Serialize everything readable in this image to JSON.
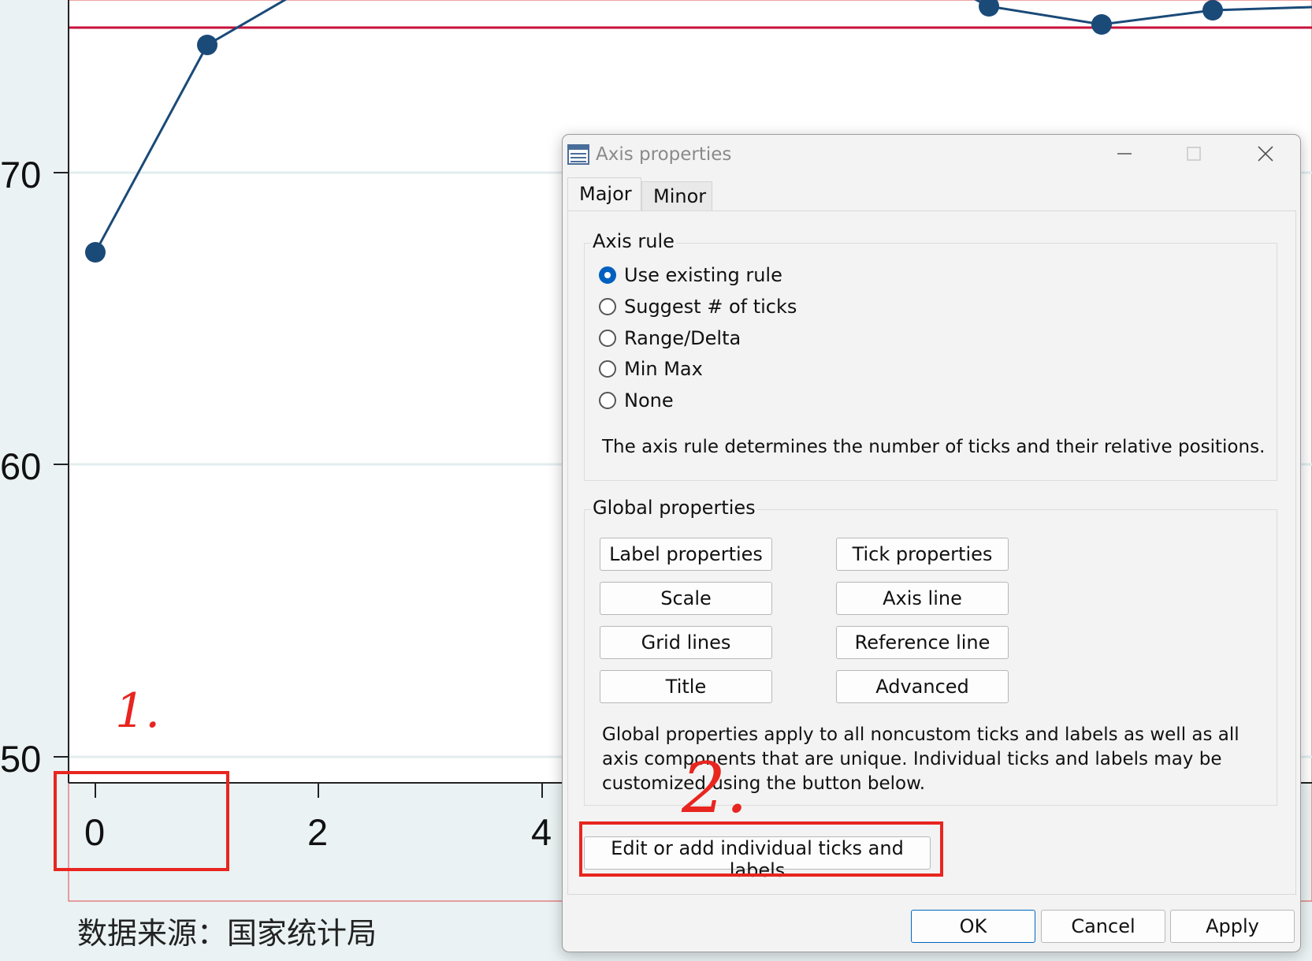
{
  "graph": {
    "y_tick_labels": [
      "70",
      "60",
      "50"
    ],
    "x_tick_labels": [
      "0",
      "2",
      "4"
    ],
    "source_note": "数据来源：国家统计局",
    "line_color": "#1a4a78",
    "reference_line_color": "#c8103a"
  },
  "annotations": {
    "mark_1": "1.",
    "mark_2": "2."
  },
  "dialog": {
    "title": "Axis properties",
    "tabs": [
      {
        "label": "Major",
        "selected": true
      },
      {
        "label": "Minor",
        "selected": false
      }
    ],
    "axis_rule": {
      "legend": "Axis rule",
      "options": [
        {
          "label": "Use existing rule",
          "checked": true
        },
        {
          "label": "Suggest # of ticks",
          "checked": false
        },
        {
          "label": "Range/Delta",
          "checked": false
        },
        {
          "label": "Min Max",
          "checked": false
        },
        {
          "label": "None",
          "checked": false
        }
      ],
      "description": "The axis rule determines the number of ticks and their relative positions."
    },
    "global_properties": {
      "legend": "Global properties",
      "buttons": [
        "Label properties",
        "Tick properties",
        "Scale",
        "Axis line",
        "Grid lines",
        "Reference line",
        "Title",
        "Advanced"
      ],
      "description": "Global properties apply to all noncustom ticks and labels as well as all axis components that are unique. Individual ticks and labels may be customized using the button below."
    },
    "edit_ticks_button": "Edit or add individual ticks and labels",
    "footer": {
      "ok": "OK",
      "cancel": "Cancel",
      "apply": "Apply"
    }
  }
}
